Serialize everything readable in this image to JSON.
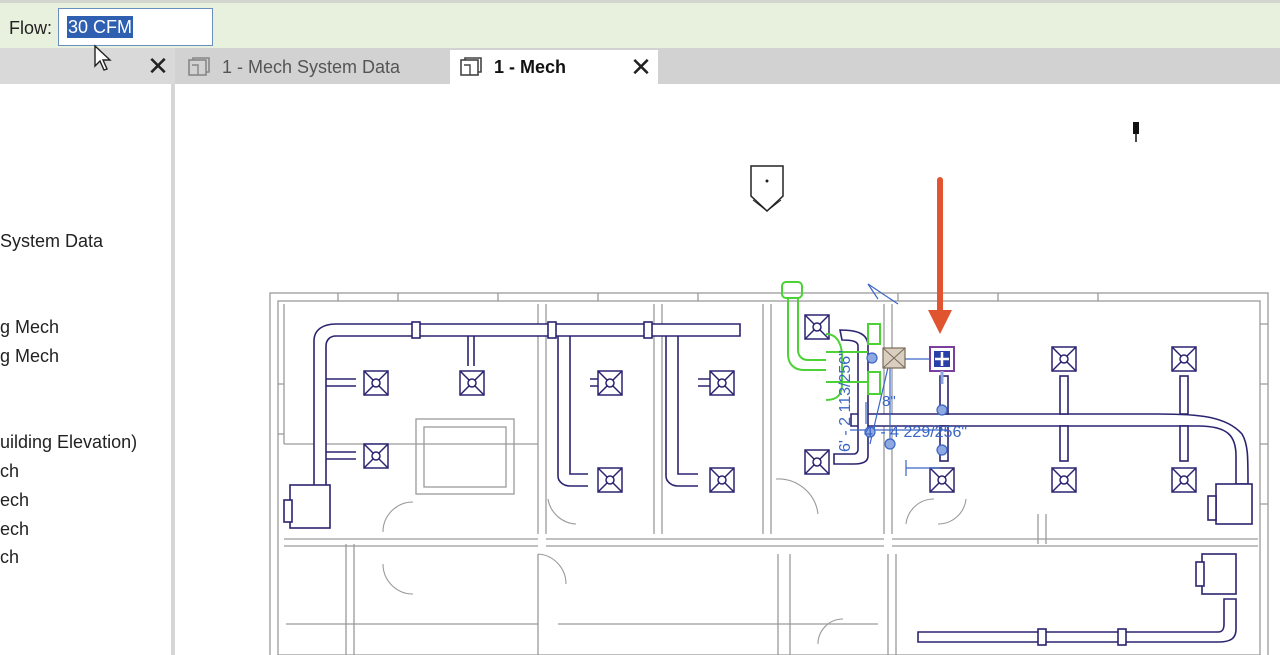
{
  "options_bar": {
    "flow_label": "Flow:",
    "flow_value": "30 CFM"
  },
  "tabs": [
    {
      "label": "1 - Mech System Data",
      "active": false
    },
    {
      "label": "1 - Mech",
      "active": true
    }
  ],
  "project_browser": {
    "items": [
      "System Data",
      "g Mech",
      "g Mech",
      "uilding Elevation)",
      "ch",
      "ech",
      "ech",
      "ch"
    ]
  },
  "drawing": {
    "dimension_1": "6' - 2 113/256\"",
    "dimension_2": "4' - 4 229/256\"",
    "dimension_3": "8\"",
    "highlight_color": "#e0552f",
    "duct_color": "#2b2470",
    "selection_color": "#4cd137"
  }
}
